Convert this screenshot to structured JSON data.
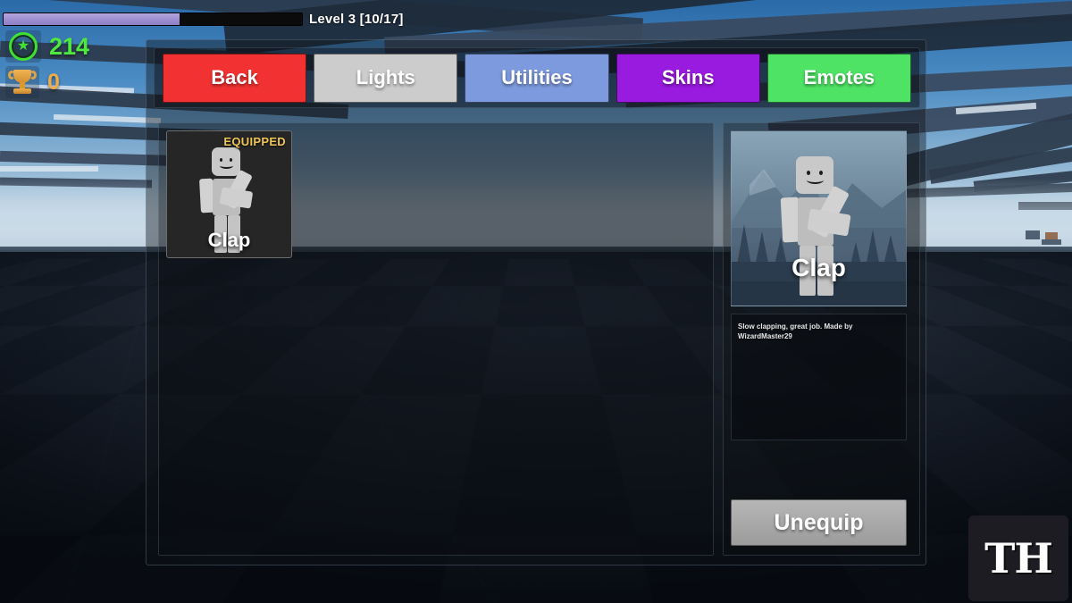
{
  "hud": {
    "xp_bar": {
      "level_text": "Level 3 [10/17]",
      "current": 10,
      "max": 17,
      "fill_percent": 59,
      "fill_color": "#9f90d2",
      "track_color": "#0b0b0b"
    },
    "coins": {
      "icon": "star-coin-icon",
      "value": "214",
      "color": "#4fe83f"
    },
    "trophies": {
      "icon": "trophy-icon",
      "value": "0",
      "color": "#eeac4a"
    }
  },
  "menu": {
    "tabs": [
      {
        "label": "Back",
        "color": "#f23232",
        "name": "tab-back"
      },
      {
        "label": "Lights",
        "color": "#cccccc",
        "name": "tab-lights"
      },
      {
        "label": "Utilities",
        "color": "#7d9ade",
        "name": "tab-utilities"
      },
      {
        "label": "Skins",
        "color": "#9a1be0",
        "name": "tab-skins"
      },
      {
        "label": "Emotes",
        "color": "#4ee364",
        "name": "tab-emotes"
      }
    ],
    "items": [
      {
        "name": "Clap",
        "badge": "EQUIPPED",
        "equipped": true
      }
    ]
  },
  "detail": {
    "preview_name": "Clap",
    "description": "Slow clapping, great job. Made by WizardMaster29",
    "action_label": "Unequip"
  },
  "watermark": {
    "text": "TH"
  }
}
